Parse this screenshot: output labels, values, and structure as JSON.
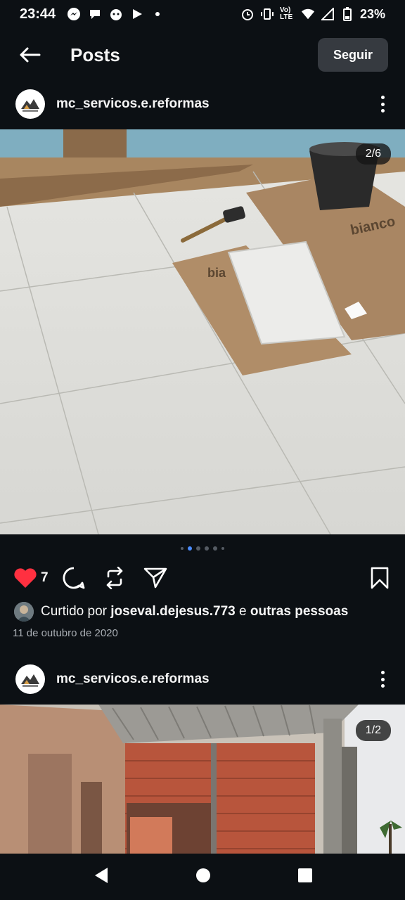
{
  "status_bar": {
    "time": "23:44",
    "network": "Vo) LTE",
    "battery": "23%",
    "icons": [
      "messenger-icon",
      "chat-icon",
      "bot-icon",
      "play-icon",
      "alarm-icon",
      "vibrate-icon",
      "wifi-icon",
      "signal-icon",
      "battery-icon"
    ]
  },
  "header": {
    "title": "Posts",
    "follow_label": "Seguir"
  },
  "posts": [
    {
      "username": "mc_servicos.e.reformas",
      "counter": "2/6",
      "likes": "7",
      "liked_prefix": "Curtido por",
      "liked_user": "joseval.dejesus.773",
      "liked_conj": "e",
      "liked_others": "outras pessoas",
      "date": "11 de outubro de 2020",
      "carousel_count": 6,
      "carousel_active": 2,
      "box_text_1": "bianco",
      "box_text_2": "bia"
    },
    {
      "username": "mc_servicos.e.reformas",
      "counter": "1/2"
    }
  ],
  "colors": {
    "background": "#0c1014",
    "like": "#ff3040",
    "active_dot": "#4a8cff"
  }
}
